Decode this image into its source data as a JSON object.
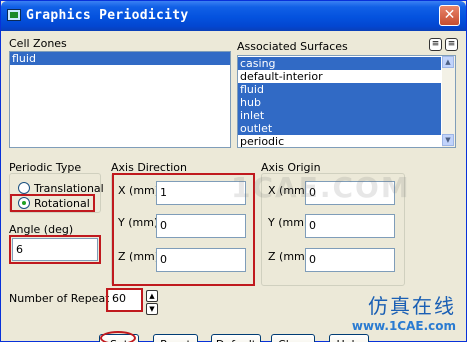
{
  "window": {
    "title": "Graphics Periodicity"
  },
  "cell_zones": {
    "label": "Cell Zones",
    "items": [
      {
        "label": "fluid",
        "selected": true
      }
    ]
  },
  "associated_surfaces": {
    "label": "Associated Surfaces",
    "items": [
      {
        "label": "casing",
        "selected": true
      },
      {
        "label": "default-interior",
        "selected": false
      },
      {
        "label": "fluid",
        "selected": true
      },
      {
        "label": "hub",
        "selected": true
      },
      {
        "label": "inlet",
        "selected": true
      },
      {
        "label": "outlet",
        "selected": true
      },
      {
        "label": "periodic",
        "selected": false
      }
    ]
  },
  "periodic_type": {
    "label": "Periodic Type",
    "options": [
      {
        "label": "Translational",
        "selected": false
      },
      {
        "label": "Rotational",
        "selected": true
      }
    ]
  },
  "angle": {
    "label": "Angle (deg)",
    "value": "6"
  },
  "axis_direction": {
    "label": "Axis Direction",
    "x_label": "X (mm)",
    "x_value": "1",
    "y_label": "Y (mm)",
    "y_value": "0",
    "z_label": "Z (mm)",
    "z_value": "0"
  },
  "axis_origin": {
    "label": "Axis Origin",
    "x_label": "X (mm)",
    "x_value": "0",
    "y_label": "Y (mm)",
    "y_value": "0",
    "z_label": "Z (mm)",
    "z_value": "0"
  },
  "repeats": {
    "label": "Number of Repeats",
    "value": "60"
  },
  "buttons": {
    "set": "Set",
    "reset": "Reset",
    "default": "Default",
    "close": "Close",
    "help": "Help"
  },
  "watermark": {
    "chinese": "仿真在线",
    "url": "www.1CAE.com",
    "center": "1CAE.COM"
  },
  "colors": {
    "highlight": "#c0191e",
    "selection": "#316ac5"
  }
}
